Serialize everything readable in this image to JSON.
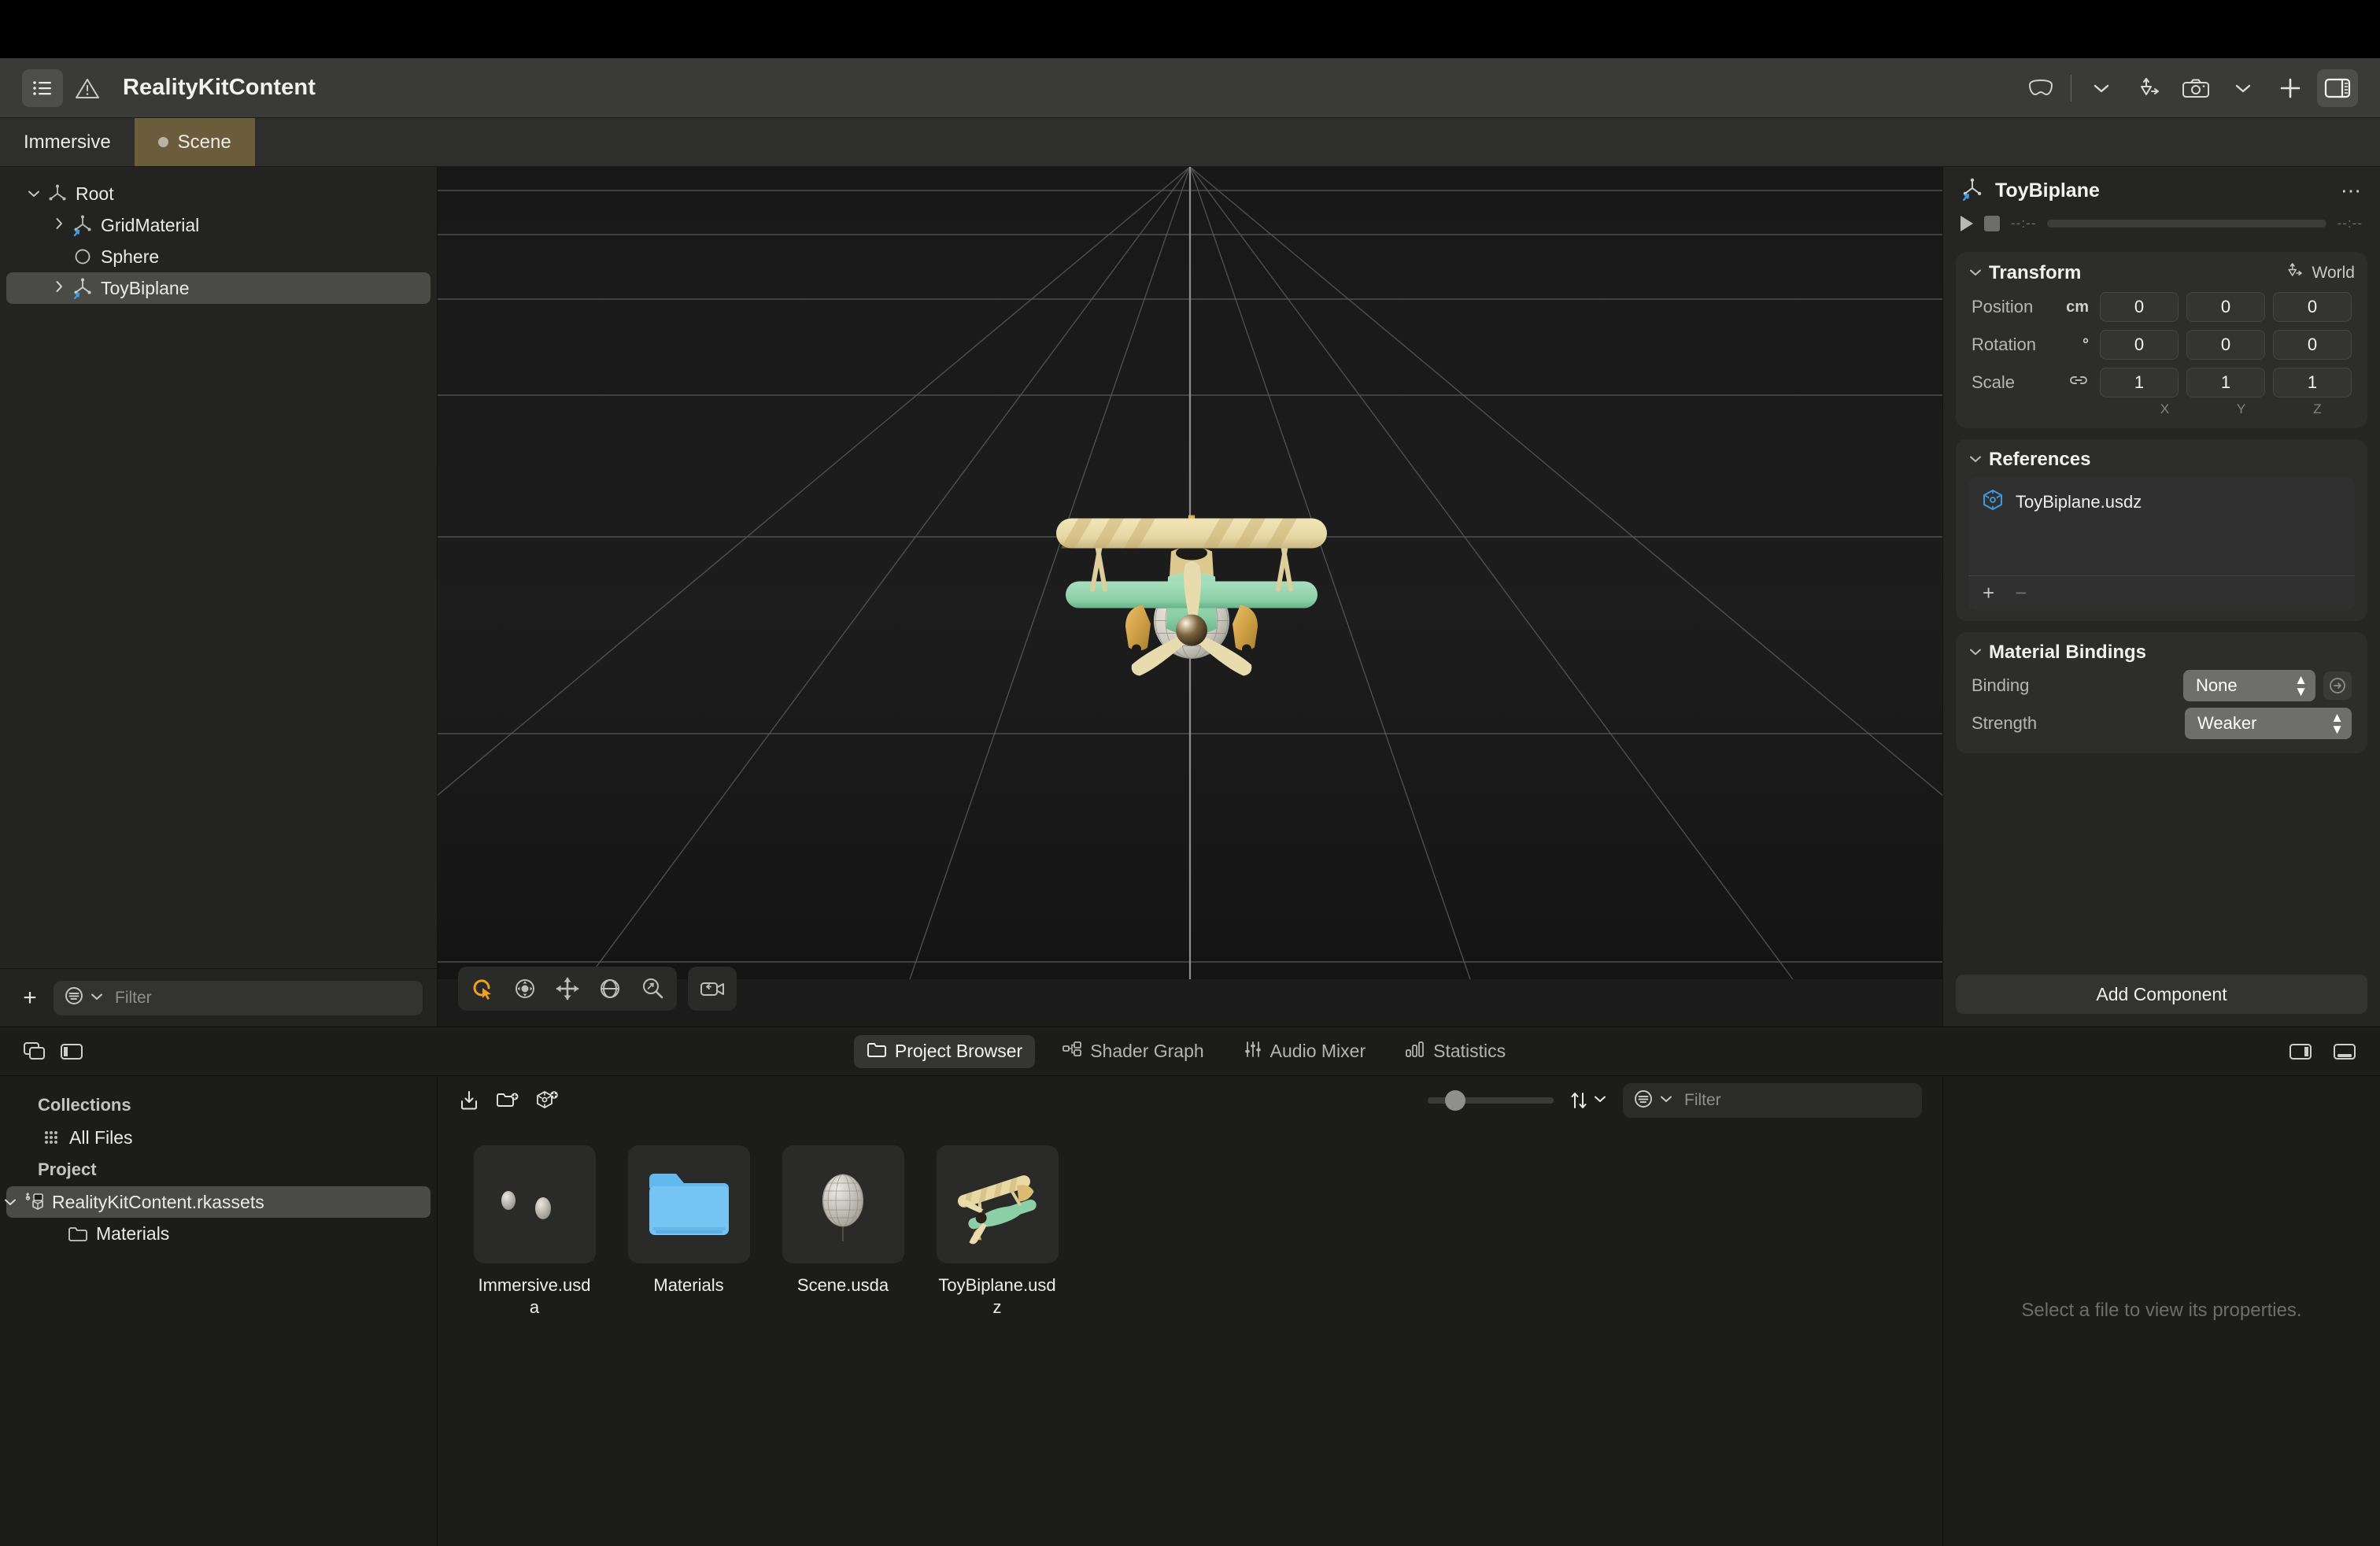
{
  "window": {
    "title": "RealityKitContent"
  },
  "toolbar": {
    "sidebar_toggle_icon": "list-bullet-icon",
    "warning_icon": "warning-triangle-icon",
    "device_icon": "vision-pro-icon",
    "device_chevron": "chevron-down-icon",
    "gizmo_icon": "transform-gizmo-icon",
    "camera_icon": "camera-icon",
    "camera_chevron": "chevron-down-icon",
    "add_icon": "plus-icon",
    "inspector_toggle_icon": "right-panel-icon"
  },
  "tabs": [
    {
      "label": "Immersive",
      "selected": false,
      "has_dot": false
    },
    {
      "label": "Scene",
      "selected": true,
      "has_dot": true
    }
  ],
  "outline": {
    "items": [
      {
        "label": "Root",
        "depth": 0,
        "disclosure": "open",
        "icon": "entity-axis-icon",
        "selected": false
      },
      {
        "label": "GridMaterial",
        "depth": 1,
        "disclosure": "closed",
        "icon": "entity-axis-icon",
        "selected": false
      },
      {
        "label": "Sphere",
        "depth": 1,
        "disclosure": "none",
        "icon": "circle-icon",
        "selected": false
      },
      {
        "label": "ToyBiplane",
        "depth": 1,
        "disclosure": "closed",
        "icon": "entity-axis-icon",
        "selected": true
      }
    ],
    "footer": {
      "add_label": "+",
      "filter_icon": "filter-icon",
      "filter_chevron": "chevron-down-icon",
      "filter_placeholder": "Filter",
      "filter_value": ""
    }
  },
  "viewport": {
    "tools": [
      {
        "name": "select-tool",
        "icon": "cursor-arrow-icon",
        "active": true
      },
      {
        "name": "orbit-tool",
        "icon": "orbit-icon",
        "active": false
      },
      {
        "name": "pan-tool",
        "icon": "move-arrows-icon",
        "active": false
      },
      {
        "name": "rotate-tool",
        "icon": "globe-rotate-icon",
        "active": false
      },
      {
        "name": "zoom-tool",
        "icon": "magnifier-icon",
        "active": false
      }
    ],
    "camera_reset_icon": "camera-reset-icon"
  },
  "inspector": {
    "title": "ToyBiplane",
    "entity_icon": "entity-axis-icon",
    "more_icon": "ellipsis-icon",
    "player": {
      "play_icon": "play-icon",
      "stop_icon": "stop-icon",
      "time_start": "--:--",
      "time_end": "--:--"
    },
    "transform": {
      "title": "Transform",
      "space_label": "World",
      "space_icon": "transform-gizmo-icon",
      "axis_labels": [
        "X",
        "Y",
        "Z"
      ],
      "rows": [
        {
          "label": "Position",
          "unit": "cm",
          "values": [
            "0",
            "0",
            "0"
          ]
        },
        {
          "label": "Rotation",
          "unit": "°",
          "values": [
            "0",
            "0",
            "0"
          ]
        },
        {
          "label": "Scale",
          "unit": "link",
          "values": [
            "1",
            "1",
            "1"
          ]
        }
      ]
    },
    "references": {
      "title": "References",
      "items": [
        {
          "name": "ToyBiplane.usdz",
          "icon": "usdz-cube-icon"
        }
      ],
      "add_label": "+",
      "remove_label": "−"
    },
    "material_bindings": {
      "title": "Material Bindings",
      "rows": [
        {
          "label": "Binding",
          "value": "None",
          "has_goto": true
        },
        {
          "label": "Strength",
          "value": "Weaker",
          "has_goto": false
        }
      ]
    },
    "add_component_label": "Add Component"
  },
  "bottom_panel": {
    "left_icons": [
      {
        "name": "stack-panels-icon"
      },
      {
        "name": "left-panel-icon"
      }
    ],
    "tabs": [
      {
        "label": "Project Browser",
        "icon": "folder-icon",
        "selected": true
      },
      {
        "label": "Shader Graph",
        "icon": "node-graph-icon",
        "selected": false
      },
      {
        "label": "Audio Mixer",
        "icon": "sliders-icon",
        "selected": false
      },
      {
        "label": "Statistics",
        "icon": "bar-chart-icon",
        "selected": false
      }
    ],
    "right_icons": [
      {
        "name": "right-panel-icon"
      },
      {
        "name": "bottom-panel-icon"
      }
    ],
    "collections": {
      "collections_header": "Collections",
      "all_files_label": "All Files",
      "all_files_icon": "grid-dots-icon",
      "project_header": "Project",
      "project_items": [
        {
          "label": "RealityKitContent.rkassets",
          "icon": "rkassets-icon",
          "disclosure": "open",
          "selected": true,
          "depth": 0
        },
        {
          "label": "Materials",
          "icon": "folder-icon",
          "disclosure": "none",
          "selected": false,
          "depth": 1
        }
      ]
    },
    "browser_toolbar": {
      "import_icon": "import-icon",
      "new-folder_icon": "new-folder-icon",
      "new-asset_icon": "new-asset-icon",
      "zoom_slider_value": 18,
      "sort_icon": "sort-arrows-icon",
      "sort_chevron": "chevron-down-icon",
      "filter_icon": "filter-icon",
      "filter_chevron": "chevron-down-icon",
      "filter_placeholder": "Filter",
      "filter_value": ""
    },
    "assets": [
      {
        "label": "Immersive.usda",
        "kind": "spheres-thumbnail"
      },
      {
        "label": "Materials",
        "kind": "folder-thumbnail"
      },
      {
        "label": "Scene.usda",
        "kind": "sphere-wire-thumbnail"
      },
      {
        "label": "ToyBiplane.usdz",
        "kind": "biplane-thumbnail"
      }
    ],
    "file_inspector": {
      "empty_message": "Select a file to view its properties."
    }
  },
  "colors": {
    "tab_selected": "#6b5c3c",
    "accent_blue": "#3e9ae0",
    "tool_active": "#f0a020",
    "folder_blue": "#58b6f0"
  }
}
